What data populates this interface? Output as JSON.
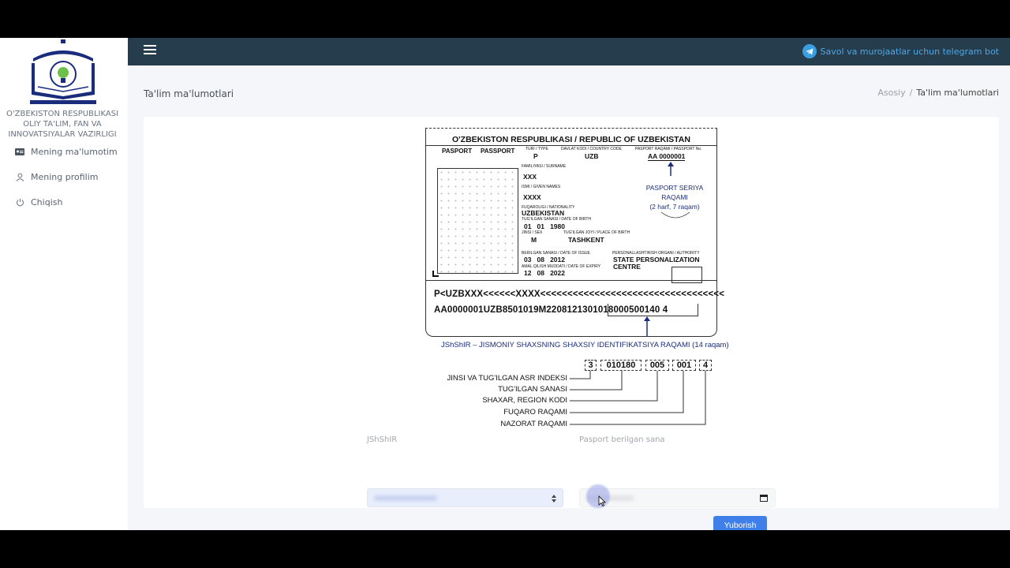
{
  "sidebar": {
    "org_name": [
      "O'ZBEKISTON RESPUBLIKASI",
      "OLIY TA'LIM, FAN VA",
      "INNOVATSIYALAR VAZIRLIGI"
    ],
    "items": [
      {
        "label": "Mening ma'lumotim",
        "icon": "id-card-icon"
      },
      {
        "label": "Mening profilim",
        "icon": "user-icon"
      },
      {
        "label": "Chiqish",
        "icon": "power-icon"
      }
    ]
  },
  "topbar": {
    "telegram_link": "Savol va murojaatlar uchun telegram bot",
    "accent": "#263d4d"
  },
  "header": {
    "title": "Ta'lim ma'lumotlari",
    "breadcrumb_home": "Asosiy",
    "breadcrumb_sep": "/",
    "breadcrumb_current": "Ta'lim ma'lumotlari"
  },
  "passport": {
    "title": "O'ZBEKISTON RESPUBLIKASI / REPUBLIC OF UZBEKISTAN",
    "pasport1": "PASPORT",
    "pasport2": "PASSPORT",
    "type_label": "TURI / TYPE",
    "type_value": "P",
    "country_label": "DAVLAT KODI / COUNTRY CODE",
    "country_value": "UZB",
    "number_label": "PASPORT RAQAMI / PASSPORT No.",
    "number_value": "AA 0000001",
    "surname_label": "FAMILIYASI / SURNAME",
    "surname_value": "XXX",
    "given_label": "ISMI / GIVEN NAMES",
    "given_value": "XXXX",
    "nationality_label": "FUQAROLIGI / NATIONALITY",
    "nationality_value": "UZBEKISTAN",
    "dob_label": "TUG'ILGAN SANASI / DATE OF BIRTH",
    "dob_value": "01   01   1980",
    "sex_label": "JINSI / SEX",
    "sex_value": "M",
    "pob_label": "TUG'ILGAN JOYI / PLACE OF BIRTH",
    "pob_value": "TASHKENT",
    "issue_label": "BERILGAN SANASI / DATE OF ISSUE",
    "issue_value": "03   08   2012",
    "authority_label": "PERSONALLASHTIRISH ORGANI / AUTHORITY",
    "authority_value1": "STATE PERSONALIZATION",
    "authority_value2": "CENTRE",
    "expiry_label": "AMAL QILISH MUDDATI / DATE OF EXPIRY",
    "expiry_value": "12   08   2022",
    "series_note1": "PASPORT SERIYA",
    "series_note2": "RAQAMI",
    "series_note3": "(2 harf, 7 raqam)",
    "mrz1": "P<UZBXXX<<<<<<XXXX<<<<<<<<<<<<<<<<<<<<<<<<<<<<<<<<<<",
    "mrz2": "AA0000001UZB8501019M2208121301018000500140 4"
  },
  "jshshir_caption": "JShShIR – JISMONIY SHAXSNING SHAXSIY IDENTIFIKATSIYA RAQAMI (14 raqam)",
  "segments": [
    "3",
    "010180",
    "005",
    "001",
    "4"
  ],
  "legend": [
    "JINSI VA TUG'ILGAN ASR INDEKSI",
    "TUG'ILGAN SANASI",
    "SHAXAR, REGION KODI",
    "FUQARO RAQAMI",
    "NAZORAT RAQAMI"
  ],
  "form": {
    "jshshir_label": "JShShIR",
    "date_label": "Pasport berilgan sana",
    "submit": "Yuborish"
  }
}
